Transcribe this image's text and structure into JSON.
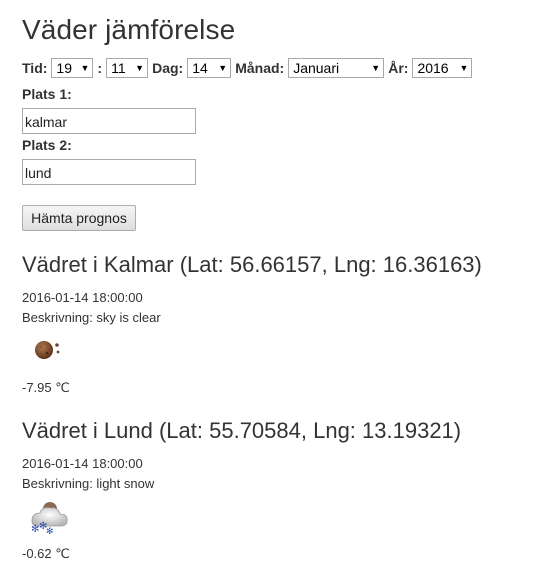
{
  "page": {
    "title": "Väder jämförelse"
  },
  "form": {
    "time_label": "Tid:",
    "hour": "19",
    "time_sep": ":",
    "minute": "11",
    "day_label": "Dag:",
    "day": "14",
    "month_label": "Månad:",
    "month": "Januari",
    "year_label": "År:",
    "year": "2016",
    "place1_label": "Plats 1:",
    "place1_value": "kalmar",
    "place2_label": "Plats 2:",
    "place2_value": "lund",
    "fetch_button": "Hämta prognos"
  },
  "results": [
    {
      "heading": "Vädret i Kalmar (Lat: 56.66157, Lng: 16.36163)",
      "datetime": "2016-01-14 18:00:00",
      "description": "Beskrivning: sky is clear",
      "icon": "night-clear-icon",
      "temperature": "-7.95 ℃"
    },
    {
      "heading": "Vädret i Lund (Lat: 55.70584, Lng: 13.19321)",
      "datetime": "2016-01-14 18:00:00",
      "description": "Beskrivning: light snow",
      "icon": "night-snow-icon",
      "temperature": "-0.62 ℃"
    }
  ],
  "colors": {
    "text": "#333333",
    "moon": "#7a4a2a",
    "snow": "#3a5bb8"
  }
}
